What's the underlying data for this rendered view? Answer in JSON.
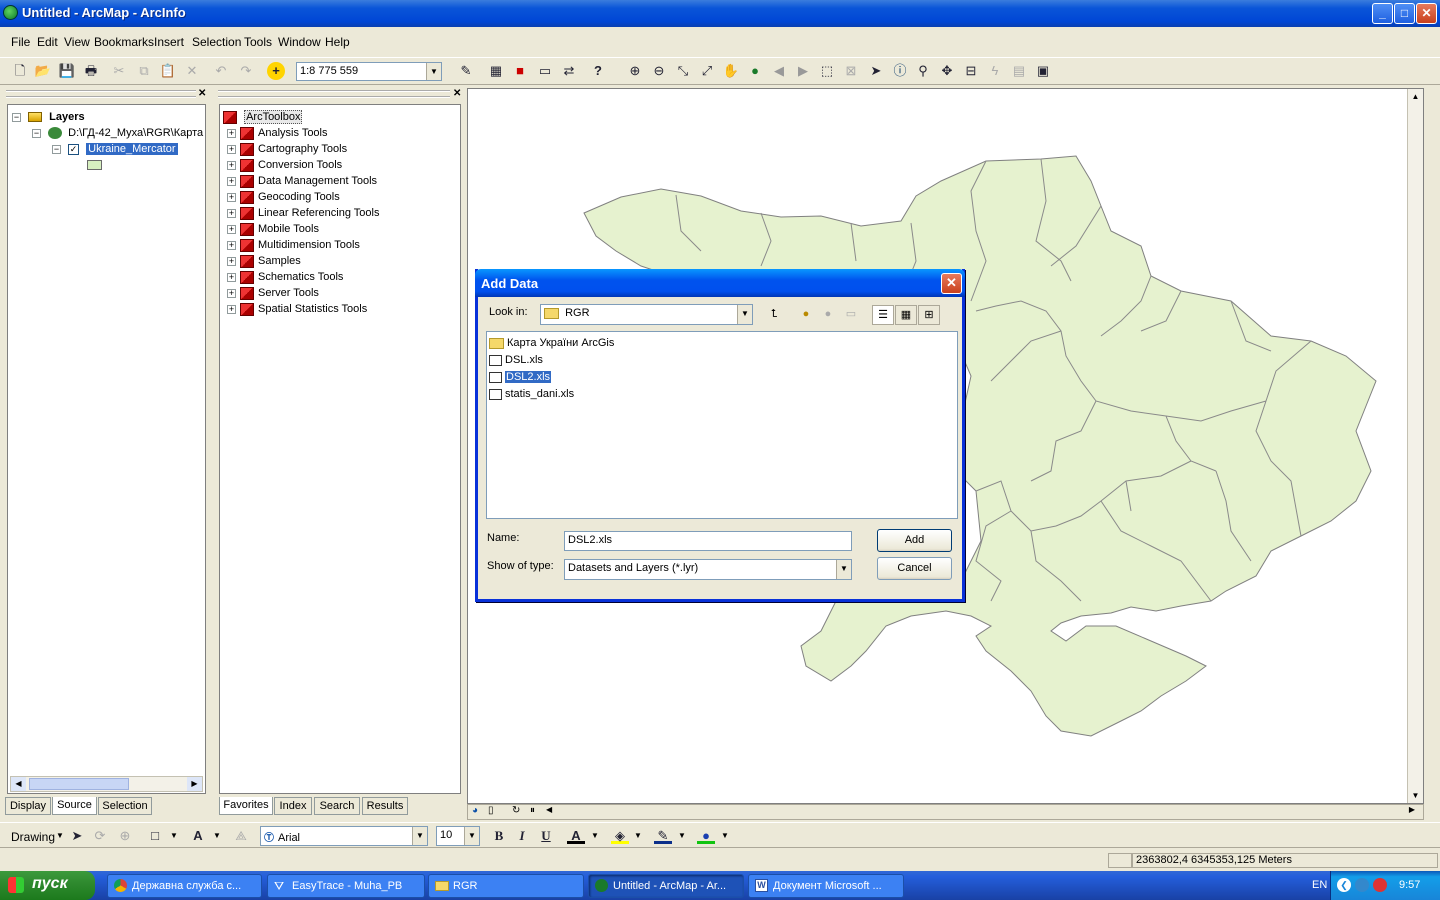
{
  "window": {
    "title": "Untitled - ArcMap - ArcInfo",
    "min": "_",
    "max": "□",
    "close": "✕"
  },
  "menu": [
    "File",
    "Edit",
    "View",
    "Bookmarks",
    "Insert",
    "Selection",
    "Tools",
    "Window",
    "Help"
  ],
  "toolbar": {
    "scale": "1:8 775 559"
  },
  "toc": {
    "root": "Layers",
    "path": "D:\\ГД-42_Муха\\RGR\\Карта",
    "layer": "Ukraine_Mercator",
    "tabs": [
      "Display",
      "Source",
      "Selection"
    ]
  },
  "toolbox": {
    "root": "ArcToolbox",
    "items": [
      "Analysis Tools",
      "Cartography Tools",
      "Conversion Tools",
      "Data Management Tools",
      "Geocoding Tools",
      "Linear Referencing Tools",
      "Mobile Tools",
      "Multidimension Tools",
      "Samples",
      "Schematics Tools",
      "Server Tools",
      "Spatial Statistics Tools"
    ],
    "tabs": [
      "Favorites",
      "Index",
      "Search",
      "Results"
    ]
  },
  "dialog": {
    "title": "Add Data",
    "look_in_label": "Look in:",
    "look_in_value": "RGR",
    "files": [
      "Карта України ArcGis",
      "DSL.xls",
      "DSL2.xls",
      "statis_dani.xls"
    ],
    "selected_file": "DSL2.xls",
    "name_label": "Name:",
    "name_value": "DSL2.xls",
    "type_label": "Show of type:",
    "type_value": "Datasets and Layers (*.lyr)",
    "add_label": "Add",
    "cancel_label": "Cancel"
  },
  "drawing": {
    "label": "Drawing",
    "font": "Arial",
    "size": "10",
    "bold": "B",
    "italic": "I",
    "underline": "U"
  },
  "status": {
    "coords": "2363802,4  6345353,125 Meters"
  },
  "taskbar": {
    "start": "пуск",
    "items": [
      "Державна служба с...",
      "EasyTrace - Muha_PB",
      "RGR",
      "Untitled - ArcMap - Ar...",
      "Документ Microsoft ..."
    ],
    "lang": "EN",
    "time": "9:57"
  },
  "colors": {
    "map_fill": "#e6f2cf",
    "map_stroke": "#7a7a7a",
    "selection": "#316ac5"
  }
}
